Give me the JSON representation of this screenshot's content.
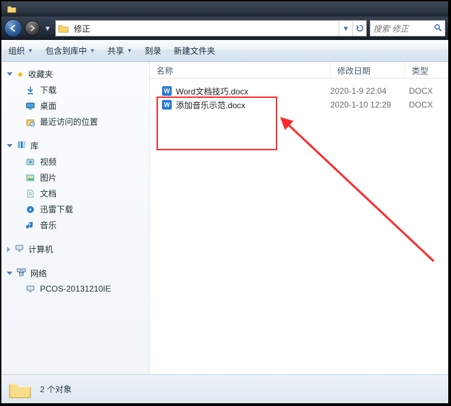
{
  "address": {
    "path": "修正"
  },
  "search": {
    "placeholder": "搜索 修正"
  },
  "toolbar": {
    "organize": "组织",
    "include": "包含到库中",
    "share": "共享",
    "burn": "刻录",
    "newfolder": "新建文件夹"
  },
  "sidebar": {
    "favorites": {
      "label": "收藏夹",
      "items": [
        "下载",
        "桌面",
        "最近访问的位置"
      ]
    },
    "libraries": {
      "label": "库",
      "items": [
        "视频",
        "图片",
        "文档",
        "迅雷下载",
        "音乐"
      ]
    },
    "computer": {
      "label": "计算机"
    },
    "network": {
      "label": "网络",
      "items": [
        "PCOS-20131210IE"
      ]
    }
  },
  "columns": {
    "name": "名称",
    "date": "修改日期",
    "type": "类型"
  },
  "files": [
    {
      "name": "Word文档技巧.docx",
      "date": "2020-1-9 22:04",
      "type": "DOCX"
    },
    {
      "name": "添加音乐示范.docx",
      "date": "2020-1-10 12:29",
      "type": "DOCX"
    }
  ],
  "status": {
    "count_text": "2 个对象"
  }
}
